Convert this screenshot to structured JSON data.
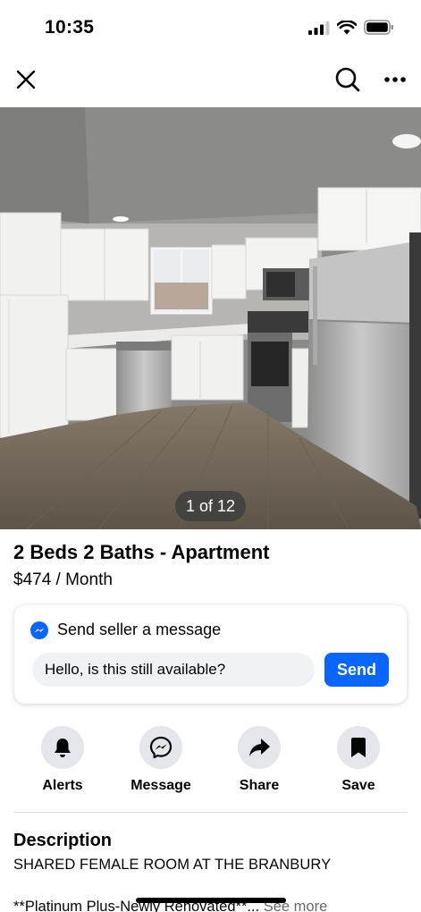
{
  "status_bar": {
    "time": "10:35"
  },
  "nav": {
    "close_icon": "close-icon",
    "search_icon": "search-icon",
    "more_icon": "more-icon"
  },
  "photo": {
    "counter": "1 of 12"
  },
  "listing": {
    "title": "2 Beds 2 Baths - Apartment",
    "price": "$474 / Month"
  },
  "message": {
    "header": "Send seller a message",
    "input_value": "Hello, is this still available?",
    "send_label": "Send",
    "accent": "#0866ff"
  },
  "actions": [
    {
      "label": "Alerts",
      "icon": "bell-icon"
    },
    {
      "label": "Message",
      "icon": "messenger-icon"
    },
    {
      "label": "Share",
      "icon": "share-icon"
    },
    {
      "label": "Save",
      "icon": "bookmark-icon"
    }
  ],
  "description": {
    "heading": "Description",
    "line1": "SHARED FEMALE ROOM AT THE BRANBURY",
    "line2": "**Platinum Plus-Newly Renovated**...",
    "see_more": "See more"
  }
}
